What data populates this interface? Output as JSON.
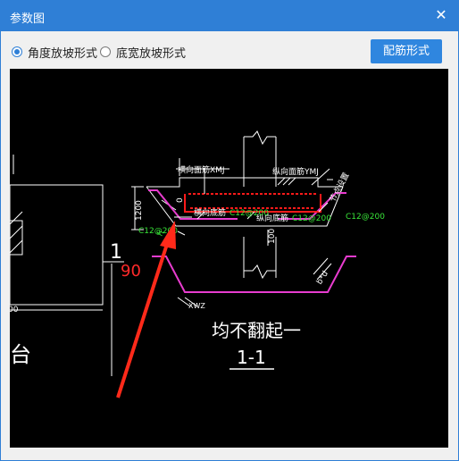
{
  "window": {
    "title": "参数图",
    "close_glyph": "✕"
  },
  "options": {
    "angle_label": "角度放坡形式",
    "width_label": "底宽放坡形式",
    "selected": "angle"
  },
  "button": {
    "rebar_form_label": "配筋形式"
  },
  "drawing": {
    "top_face_rebar_label": "横向面筋XMJ",
    "long_face_rebar_label": "纵向面筋YMJ",
    "bottom_rebar_label": "横向底筋",
    "long_bottom_rebar_label": "纵向底筋",
    "rebar_spec_left": "C12@200",
    "rebar_spec_mid": "C12@200",
    "rebar_spec_mid2": "C12@200",
    "rebar_spec_right": "C12@200",
    "corner_rebar_label": "节点设置",
    "dim_1200": "1200",
    "dim_100": "100",
    "dim_0": "0",
    "dim_h": "h",
    "dim_bxd": "b*d",
    "dim_xwz": "XWZ",
    "scale_number": "1",
    "red_angle": "90",
    "caption": "均不翻起一",
    "section_label": "1-1",
    "left_char": "台",
    "left_small": "00"
  },
  "colors": {
    "accent": "#2f7fd6",
    "canvas_bg": "#000000",
    "rebar_red": "#ff1a1a",
    "slab_magenta": "#e83ccf",
    "text_green": "#39e639"
  }
}
